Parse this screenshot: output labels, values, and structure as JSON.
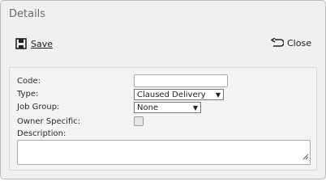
{
  "dialog": {
    "title": "Details"
  },
  "toolbar": {
    "save_label": "Save",
    "save_icon": "save-icon",
    "close_label": "Close",
    "close_icon": "return-arrow-icon"
  },
  "form": {
    "code_label": "Code:",
    "code_value": "",
    "type_label": "Type:",
    "type_value": "Claused Delivery",
    "job_group_label": "Job Group:",
    "job_group_value": "None",
    "owner_specific_label": "Owner Specific:",
    "owner_specific_checked": false,
    "description_label": "Description:",
    "description_value": ""
  }
}
